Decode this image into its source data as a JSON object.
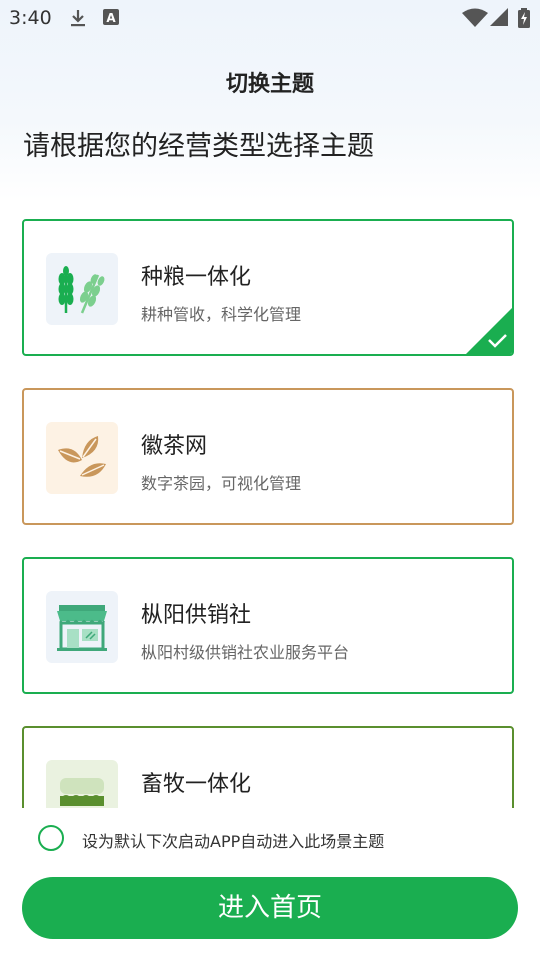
{
  "status_bar": {
    "time": "3:40",
    "icons": [
      "download-icon",
      "a-notification-icon",
      "wifi-icon",
      "signal-icon",
      "battery-charging-icon"
    ]
  },
  "header": {
    "title": "切换主题",
    "subtitle": "请根据您的经营类型选择主题"
  },
  "themes": [
    {
      "name": "种粮一体化",
      "desc": "耕种管收，科学化管理",
      "icon": "wheat-icon",
      "color": "#1aae50",
      "selected": true
    },
    {
      "name": "徽茶网",
      "desc": "数字茶园，可视化管理",
      "icon": "tea-leaf-icon",
      "color": "#c9975b",
      "selected": false
    },
    {
      "name": "枞阳供销社",
      "desc": "枞阳村级供销社农业服务平台",
      "icon": "storefront-icon",
      "color": "#1aae50",
      "selected": false
    },
    {
      "name": "畜牧一体化",
      "desc": "",
      "icon": "livestock-icon",
      "color": "#5a8f2e",
      "selected": false
    }
  ],
  "footer": {
    "default_checkbox_label": "设为默认下次启动APP自动进入此场景主题",
    "enter_button": "进入首页"
  },
  "colors": {
    "accent": "#1aae50",
    "tea": "#c9975b",
    "livestock": "#5a8f2e"
  }
}
